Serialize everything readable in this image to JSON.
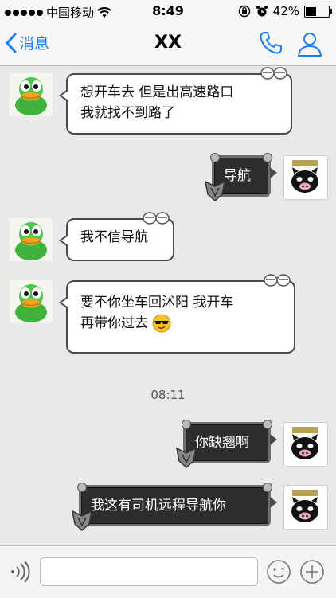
{
  "status_bar": {
    "carrier": "中国移动",
    "time": "8:49",
    "battery": "42%",
    "battery_level": 0.42
  },
  "nav": {
    "back_label": "消息",
    "title": "XX",
    "icons": {
      "call": "phone-icon",
      "profile": "person-icon"
    }
  },
  "messages": [
    {
      "side": "left",
      "lines": [
        "想开车去  但是出高速路口",
        "我就找不到路了"
      ]
    },
    {
      "side": "right",
      "text": "导航"
    },
    {
      "side": "left",
      "lines": [
        "我不信导航"
      ]
    },
    {
      "side": "left",
      "lines": [
        "要不你坐车回沭阳   我开车",
        "再带你过去"
      ],
      "emoji": "sunglasses-emoji"
    },
    {
      "side": "right",
      "text": "你缺翘啊"
    },
    {
      "side": "right",
      "text": "我这有司机远程导航你"
    }
  ],
  "timestamp": "08:11",
  "input": {
    "value": "",
    "icons": {
      "voice": "voice-icon",
      "emoji": "smiley-icon",
      "more": "plus-icon"
    }
  },
  "colors": {
    "accent": "#1a7ef2",
    "background": "#e9e9ea",
    "dark_bubble": "#2d2d2d"
  }
}
